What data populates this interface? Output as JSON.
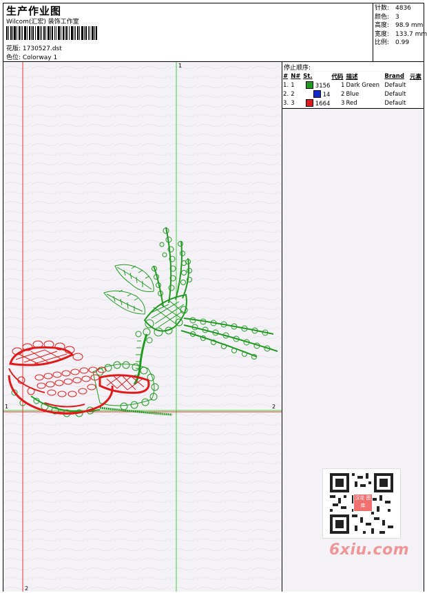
{
  "header": {
    "title": "生产作业图",
    "company": "Wilcom(汇宏) 装饰工作室",
    "design_label": "花版: 1730527.dst",
    "colorway_label": "色位: Colorway 1"
  },
  "stats": [
    {
      "key": "针数:",
      "value": "4836"
    },
    {
      "key": "颜色:",
      "value": "3"
    },
    {
      "key": "高度:",
      "value": "98.9 mm"
    },
    {
      "key": "宽度:",
      "value": "133.7 mm"
    },
    {
      "key": "比例:",
      "value": "0.99"
    }
  ],
  "stop_sequence": {
    "title": "停止顺序:",
    "columns": [
      "#",
      "N#",
      "St.",
      "代码",
      "描述",
      "Brand",
      "元素"
    ],
    "rows": [
      {
        "n": "1.",
        "nn": "1",
        "color": "#1f9a1f",
        "st": "3156",
        "code": "1",
        "desc": "Dark Green",
        "brand": "Default",
        "element": ""
      },
      {
        "n": "2.",
        "nn": "2",
        "color": "#1428d0",
        "st": "14",
        "code": "2",
        "desc": "Blue",
        "brand": "Default",
        "element": ""
      },
      {
        "n": "3.",
        "nn": "3",
        "color": "#e01a1a",
        "st": "1664",
        "code": "3",
        "desc": "Red",
        "brand": "Default",
        "element": ""
      }
    ]
  },
  "axes": {
    "red_vertical_label": "2",
    "green_vertical_label": "1",
    "left_horizontal_label": "1",
    "right_horizontal_label": "2"
  },
  "colors": {
    "green": "#1f9a1f",
    "red": "#e01a1a",
    "blue": "#1428d0",
    "green_axis": "#39d439",
    "red_axis": "#e83030"
  },
  "watermark": {
    "badge": "汉花 图库",
    "site": "6xiu.com"
  }
}
